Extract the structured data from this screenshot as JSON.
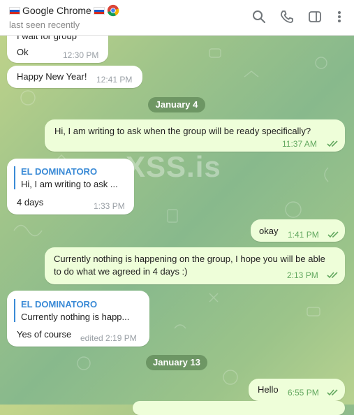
{
  "header": {
    "title_flag_left": "🇷🇺",
    "title": "Google Chrome",
    "title_flag_right": "🇷🇺",
    "status": "last seen recently",
    "icons": [
      "search-icon",
      "phone-icon",
      "sidebar-toggle-icon",
      "more-vertical-icon"
    ]
  },
  "watermark": "XSS.is",
  "messages": {
    "m1": {
      "text": "I wait for group",
      "body": "Ok",
      "time": "12:30 PM"
    },
    "m2": {
      "text": "Happy New Year!",
      "time": "12:41 PM"
    },
    "d1": "January 4",
    "m3": {
      "text": "Hi, I am writing to ask when the group will be ready specifically?",
      "time": "11:37 AM"
    },
    "m4": {
      "reply_name": "EL DOMINATORO",
      "reply_text": "Hi, I am writing to ask ...",
      "text": "4 days",
      "time": "1:33 PM"
    },
    "m5": {
      "text": "okay",
      "time": "1:41 PM"
    },
    "m6": {
      "line1": "Currently nothing is happening on the group, I hope you will be able",
      "line2": "to do what we agreed in 4 days :)",
      "time": "2:13 PM"
    },
    "m7": {
      "reply_name": "EL DOMINATORO",
      "reply_text": "Currently nothing is happ...",
      "text": "Yes of course",
      "time": "edited 2:19 PM"
    },
    "d2": "January 13",
    "m8": {
      "text": "Hello",
      "time": "6:55 PM"
    }
  },
  "colors": {
    "incoming": "#ffffff",
    "outgoing": "#eefed9",
    "accent": "#3a8ad6",
    "tick": "#62a85f"
  }
}
